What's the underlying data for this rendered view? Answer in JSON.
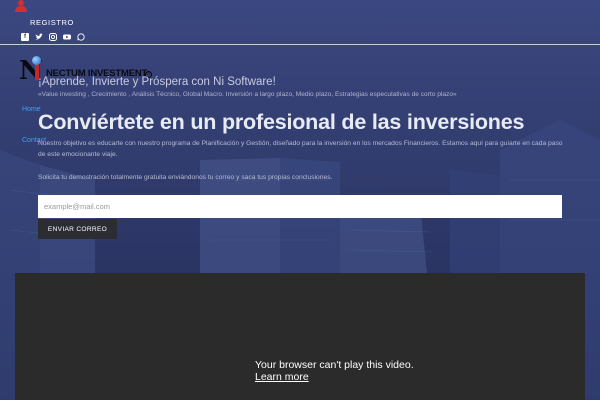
{
  "header": {
    "registro_label": "REGISTRO",
    "social_icons": [
      "facebook-icon",
      "twitter-icon",
      "instagram-icon",
      "youtube-icon",
      "whatsapp-icon"
    ]
  },
  "logo": {
    "letter": "N",
    "text": "NECTUM INVESTMENT",
    "badge": "®"
  },
  "nav": {
    "home_label": "Home",
    "contact_label": "Contact"
  },
  "hero": {
    "tagline": "¡Aprende, Invierte y Próspera con Ni Software!",
    "subtagline": "«Value investing , Crecimiento , Análisis Técnico, Global Macro. Inversión a largo plazo, Medio plazo, Estrategias especulativas de corto plazo»",
    "headline": "Conviértete en un profesional de las inversiones",
    "paragraph": "Nuestro objetivo es educarte con nuestro programa de Planificación y Gestión, diseñado para la inversión en los mercados Financieros. Estamos aquí para guiarte en cada paso de este emocionante viaje.",
    "cta_text": "Solicita tu demostración totalmente gratuita enviándonos tu correo y saca tus propias conclusiones."
  },
  "form": {
    "email_placeholder": "example@mail.com",
    "email_value": "",
    "send_label": "ENVIAR CORREO"
  },
  "video": {
    "message": "Your browser can't play this video.",
    "link_text": "Learn more"
  },
  "colors": {
    "background": "#2e3a66",
    "link": "#3ea0ff",
    "button": "#2b2d33",
    "video_bg": "#2b2b2b",
    "logo_accent": "#c62828"
  }
}
